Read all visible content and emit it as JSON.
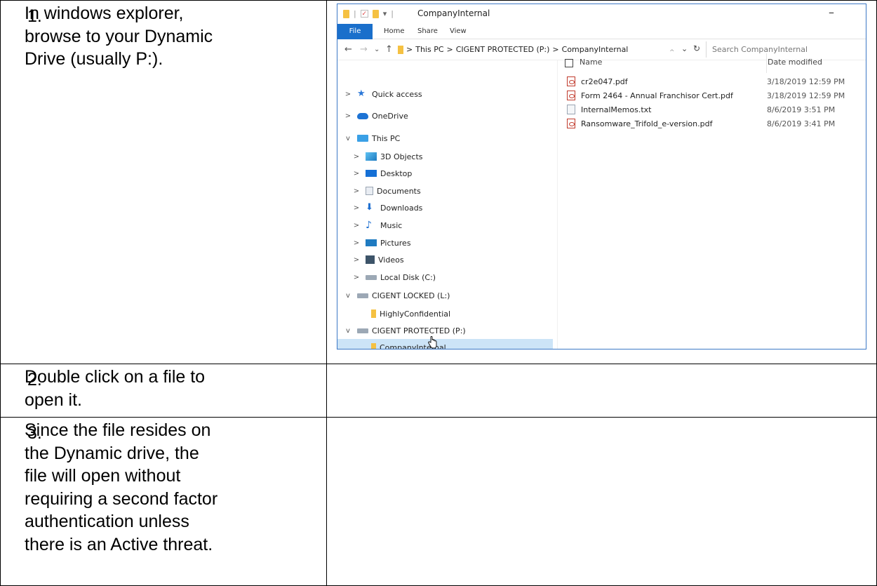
{
  "steps": [
    {
      "number": "1.",
      "lines": [
        "In windows explorer,",
        "browse to your Dynamic",
        "Drive (usually P:)."
      ]
    },
    {
      "number": "2.",
      "lines": [
        "Double click on a file to",
        "open it."
      ]
    },
    {
      "number": "3.",
      "lines": [
        "Since the file resides on",
        "the Dynamic drive, the",
        "file will open without",
        "requiring a second factor",
        "authentication unless",
        "there is an Active threat."
      ]
    }
  ],
  "explorer": {
    "window_title": "CompanyInternal",
    "ribbon": {
      "file": "File",
      "home": "Home",
      "share": "Share",
      "view": "View"
    },
    "address": {
      "this_pc": "This PC",
      "drive": "CIGENT PROTECTED (P:)",
      "folder": "CompanyInternal",
      "separator": ">"
    },
    "search_placeholder": "Search CompanyInternal",
    "columns": {
      "name": "Name",
      "date": "Date modified"
    },
    "nav": [
      {
        "label": "Quick access",
        "icon": "star-icon",
        "chevron": ">"
      },
      {
        "label": "OneDrive",
        "icon": "cloud-icon",
        "chevron": ">"
      },
      {
        "label": "This PC",
        "icon": "pc-icon",
        "chevron": "v"
      },
      {
        "label": "3D Objects",
        "icon": "cube-icon",
        "chevron": ">"
      },
      {
        "label": "Desktop",
        "icon": "desktop-icon",
        "chevron": ">"
      },
      {
        "label": "Documents",
        "icon": "documents-icon",
        "chevron": ">"
      },
      {
        "label": "Downloads",
        "icon": "download-icon",
        "chevron": ">"
      },
      {
        "label": "Music",
        "icon": "music-icon",
        "chevron": ">"
      },
      {
        "label": "Pictures",
        "icon": "pictures-icon",
        "chevron": ">"
      },
      {
        "label": "Videos",
        "icon": "videos-icon",
        "chevron": ">"
      },
      {
        "label": "Local Disk (C:)",
        "icon": "disk-icon",
        "chevron": ">"
      },
      {
        "label": "CIGENT LOCKED (L:)",
        "icon": "drive-icon",
        "chevron": "v"
      },
      {
        "label": "HighlyConfidential",
        "icon": "folder-icon",
        "chevron": ""
      },
      {
        "label": "CIGENT PROTECTED (P:)",
        "icon": "drive-icon",
        "chevron": "v"
      },
      {
        "label": "CompanyInternal",
        "icon": "folder-icon",
        "chevron": "",
        "selected": true
      }
    ],
    "files": [
      {
        "name": "cr2e047.pdf",
        "date": "3/18/2019 12:59 PM",
        "type": "pdf"
      },
      {
        "name": "Form 2464 - Annual Franchisor Cert.pdf",
        "date": "3/18/2019 12:59 PM",
        "type": "pdf"
      },
      {
        "name": "InternalMemos.txt",
        "date": "8/6/2019 3:51 PM",
        "type": "txt"
      },
      {
        "name": "Ransomware_Trifold_e-version.pdf",
        "date": "8/6/2019 3:41 PM",
        "type": "pdf"
      }
    ],
    "colors": {
      "file_tab": "#1a6fcb",
      "selection": "#cce4f7",
      "border": "#3c78c6"
    }
  }
}
